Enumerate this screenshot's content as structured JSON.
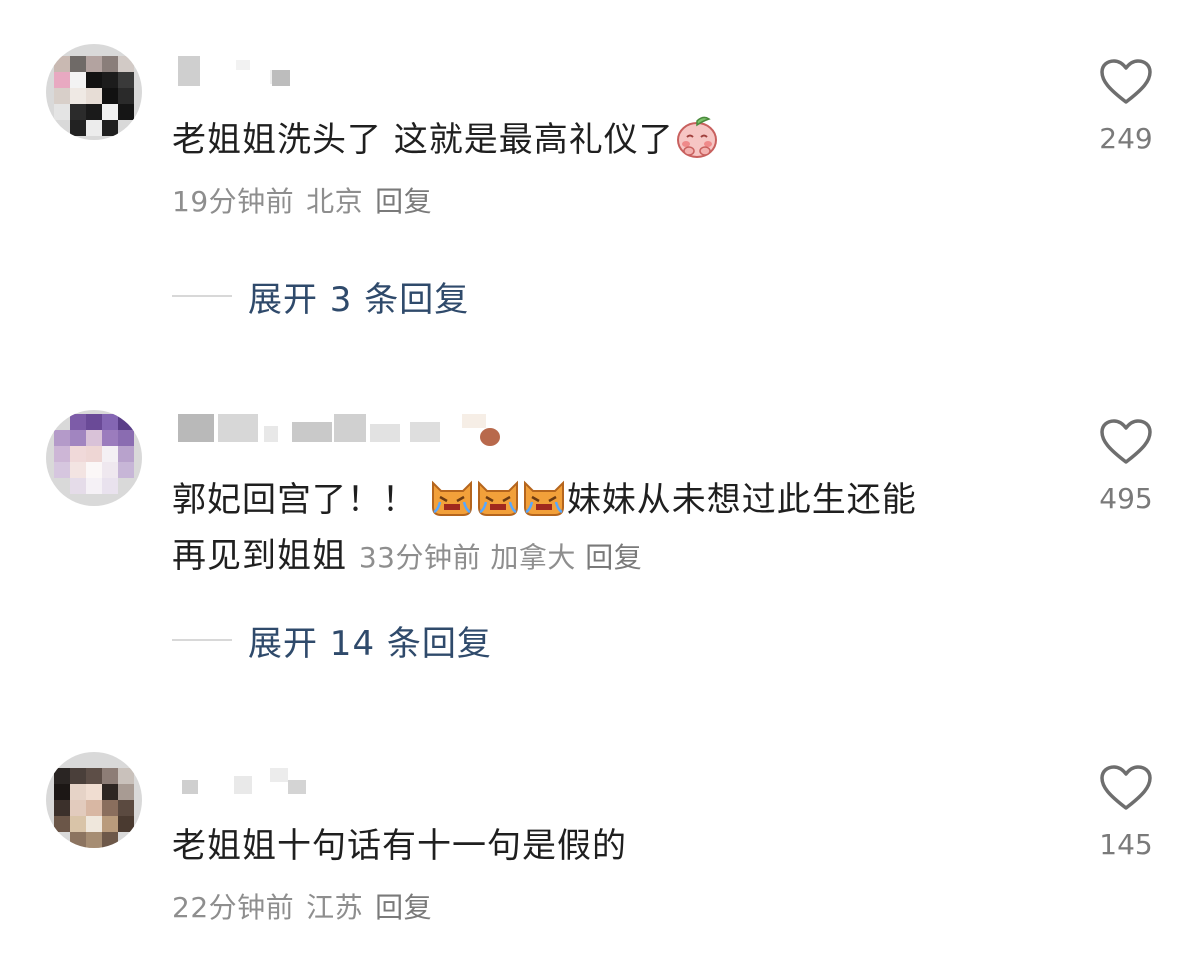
{
  "comments": [
    {
      "text": "老姐姐洗头了 这就是最高礼仪了",
      "time": "19分钟前",
      "location": "北京",
      "reply_label": "回复",
      "expand_label": "展开 3 条回复",
      "likes": "249",
      "emoji": "peach-face-emoji"
    },
    {
      "text_main": "郭妃回宫了！！",
      "text_after": "妹妹从未想过此生还能",
      "text_line2": "再见到姐姐",
      "time": "33分钟前",
      "location": "加拿大",
      "reply_label": "回复",
      "expand_label": "展开 14 条回复",
      "likes": "495",
      "emoji": "crying-cat-emoji"
    },
    {
      "text": "老姐姐十句话有十一句是假的",
      "time": "22分钟前",
      "location": "江苏",
      "reply_label": "回复",
      "likes": "145"
    }
  ],
  "icons": {
    "like": "heart-outline-icon"
  },
  "colors": {
    "link": "#2f4a6b",
    "meta": "#8e8e8e",
    "text": "#1f1f1f"
  }
}
